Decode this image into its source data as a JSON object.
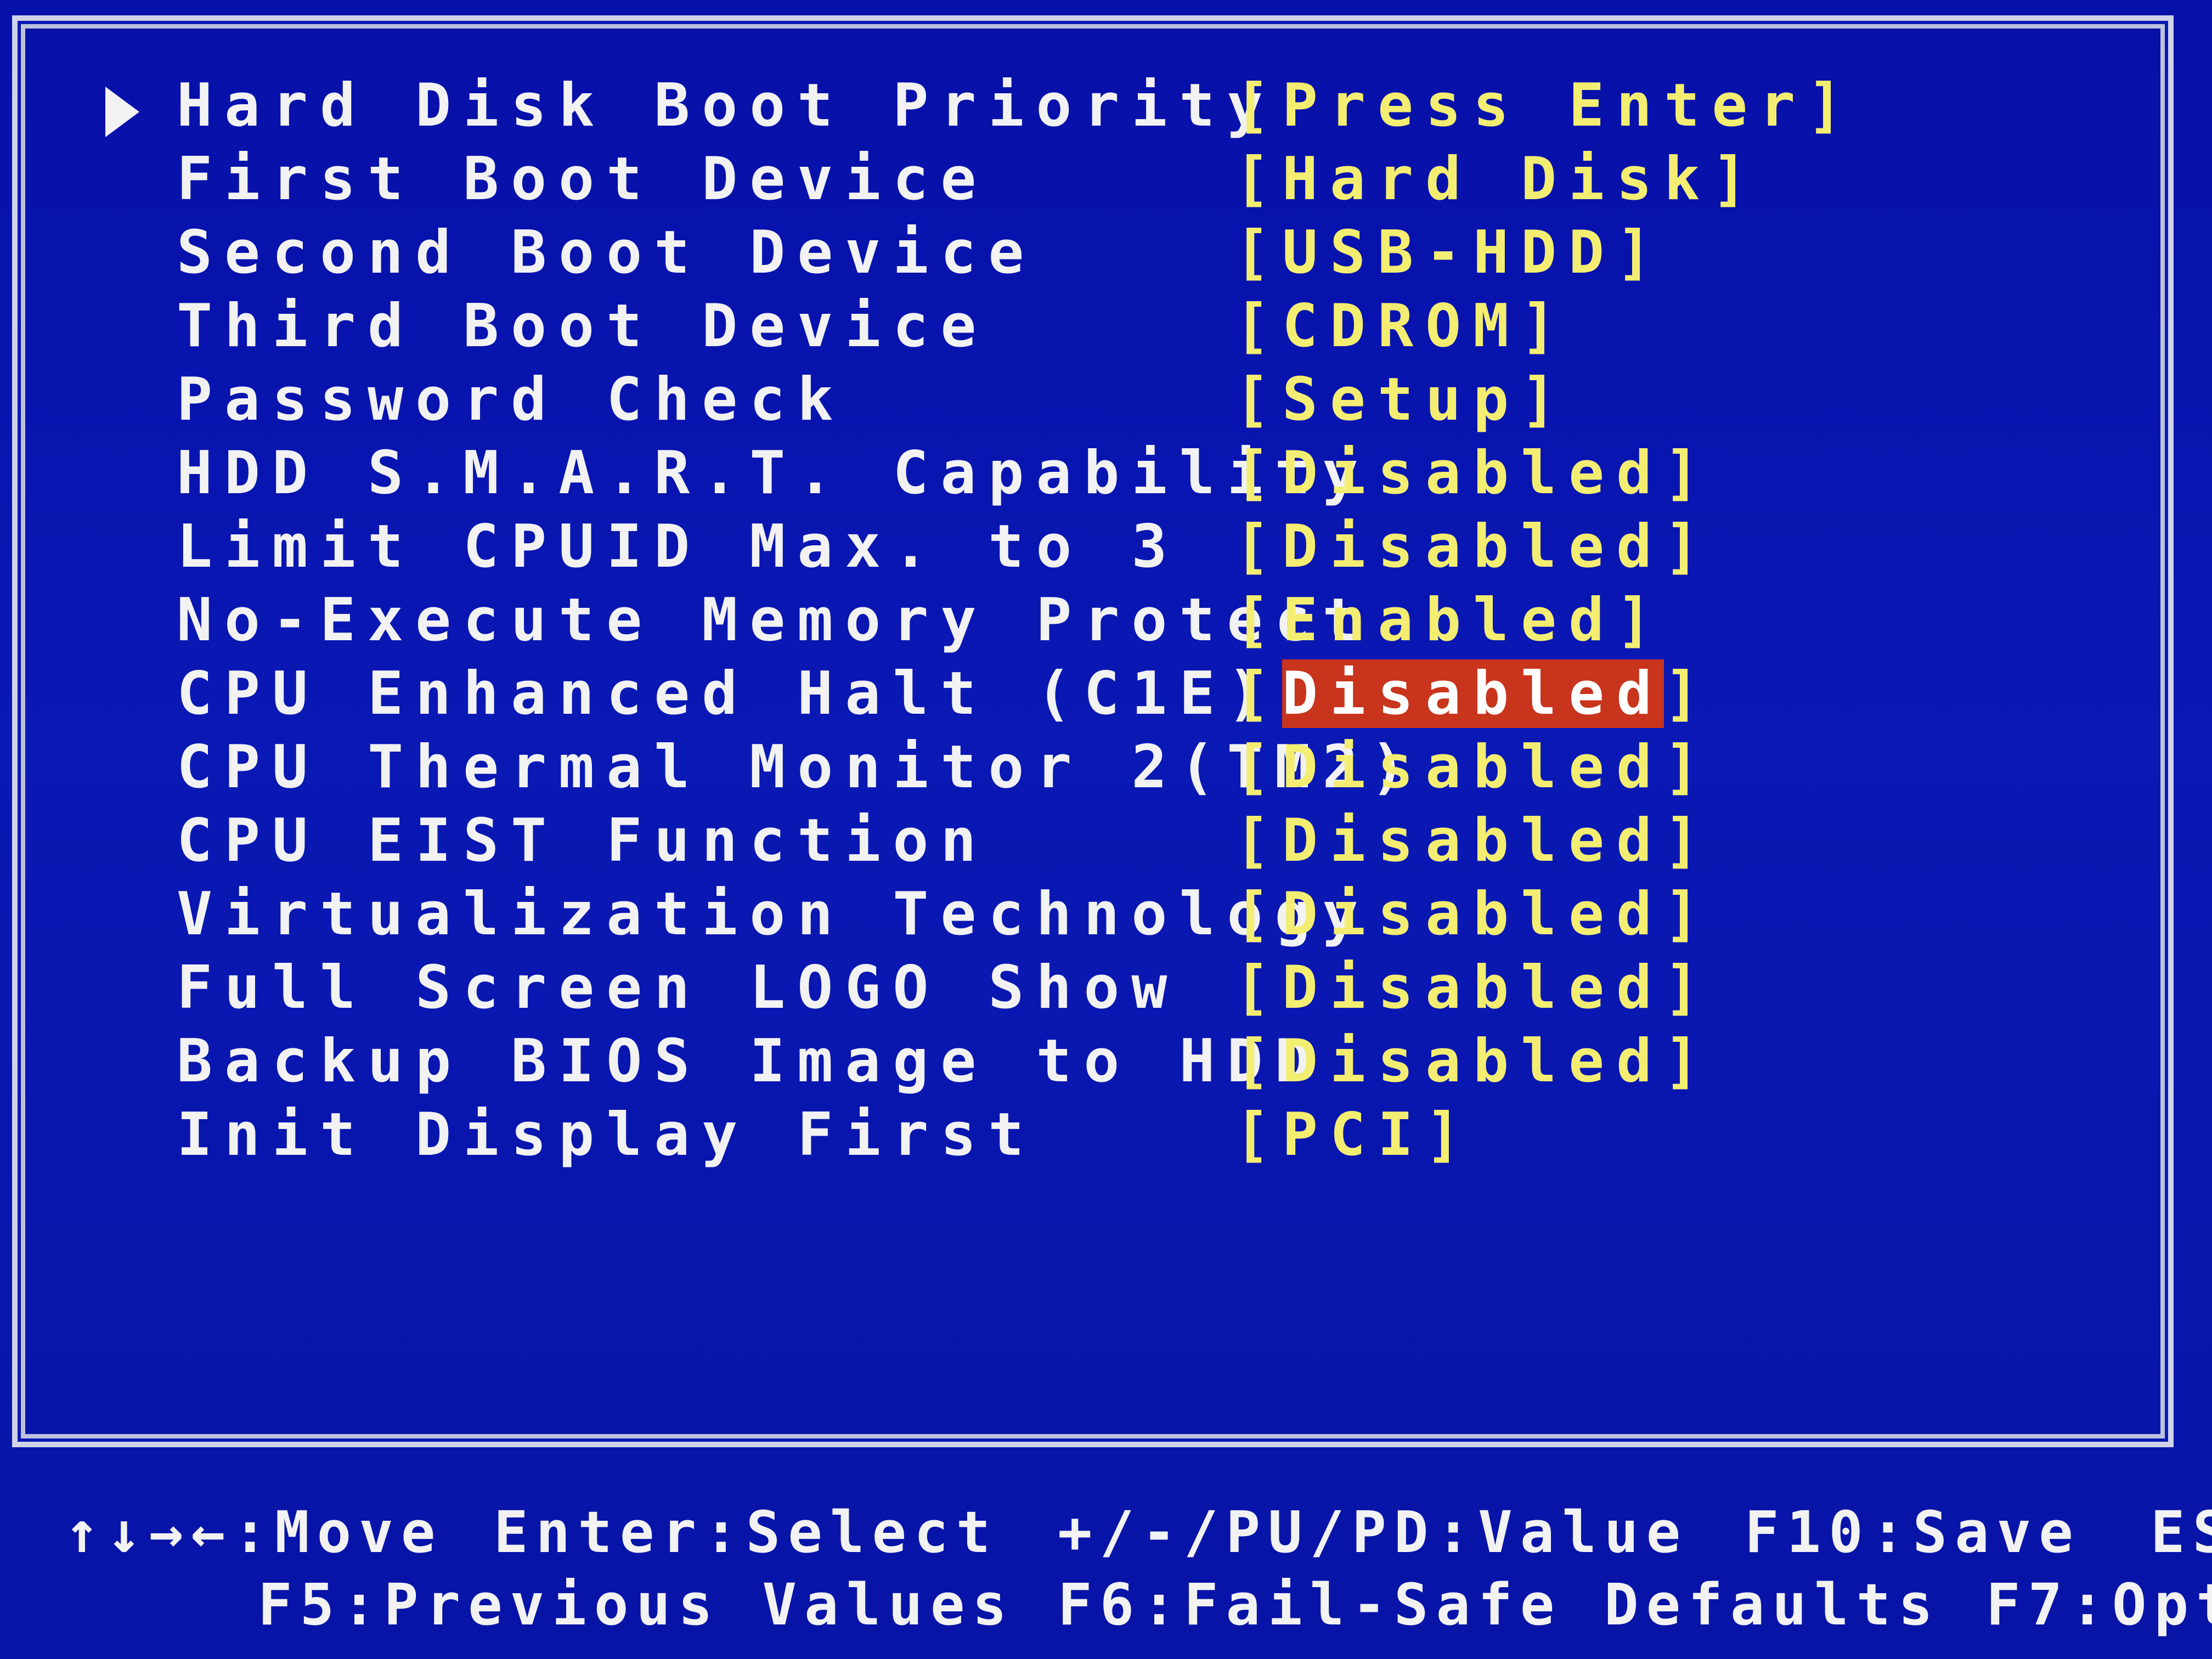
{
  "settings": {
    "rows": [
      {
        "label": "Hard Disk Boot Priority",
        "value_open": "[",
        "value": "Press Enter",
        "value_close": "]"
      },
      {
        "label": "First Boot Device",
        "value_open": "[",
        "value": "Hard Disk",
        "value_close": "]"
      },
      {
        "label": "Second Boot Device",
        "value_open": "[",
        "value": "USB-HDD",
        "value_close": "]"
      },
      {
        "label": "Third Boot Device",
        "value_open": "[",
        "value": "CDROM",
        "value_close": "]"
      },
      {
        "label": "Password Check",
        "value_open": "[",
        "value": "Setup",
        "value_close": "]"
      },
      {
        "label": "HDD S.M.A.R.T. Capability",
        "value_open": "[",
        "value": "Disabled",
        "value_close": "]"
      },
      {
        "label": "Limit CPUID Max. to 3",
        "value_open": "[",
        "value": "Disabled",
        "value_close": "]"
      },
      {
        "label": "No-Execute Memory Protect",
        "value_open": "[",
        "value": "Enabled",
        "value_close": "]"
      },
      {
        "label": "CPU Enhanced Halt (C1E)",
        "value_open": "[",
        "value": "Disabled",
        "value_close": "]"
      },
      {
        "label": "CPU Thermal Monitor 2(TM2)",
        "value_open": "[",
        "value": "Disabled",
        "value_close": "]"
      },
      {
        "label": "CPU EIST Function",
        "value_open": "[",
        "value": "Disabled",
        "value_close": "]"
      },
      {
        "label": "Virtualization Technology",
        "value_open": "[",
        "value": "Disabled",
        "value_close": "]"
      },
      {
        "label": "Full Screen LOGO Show",
        "value_open": "[",
        "value": "Disabled",
        "value_close": "]"
      },
      {
        "label": "Backup BIOS Image to HDD",
        "value_open": "[",
        "value": "Disabled",
        "value_close": "]"
      },
      {
        "label": "Init Display First",
        "value_open": "[",
        "value": "PCI",
        "value_close": "]"
      }
    ],
    "submenu_icon": "right-triangle-icon"
  },
  "help": {
    "move": "↑↓→←:Move",
    "select": "Enter:Select",
    "value": "+/-/PU/PD:Value",
    "save": "F10:Save",
    "esc": "ES",
    "previous": "F5:Previous Values",
    "failsafe": "F6:Fail-Safe Defaults",
    "optimized": "F7:Opt"
  },
  "colors": {
    "background": "#0a18b4",
    "label": "#f2f2f2",
    "value": "#f3ee72",
    "highlight": "#c8341c"
  }
}
